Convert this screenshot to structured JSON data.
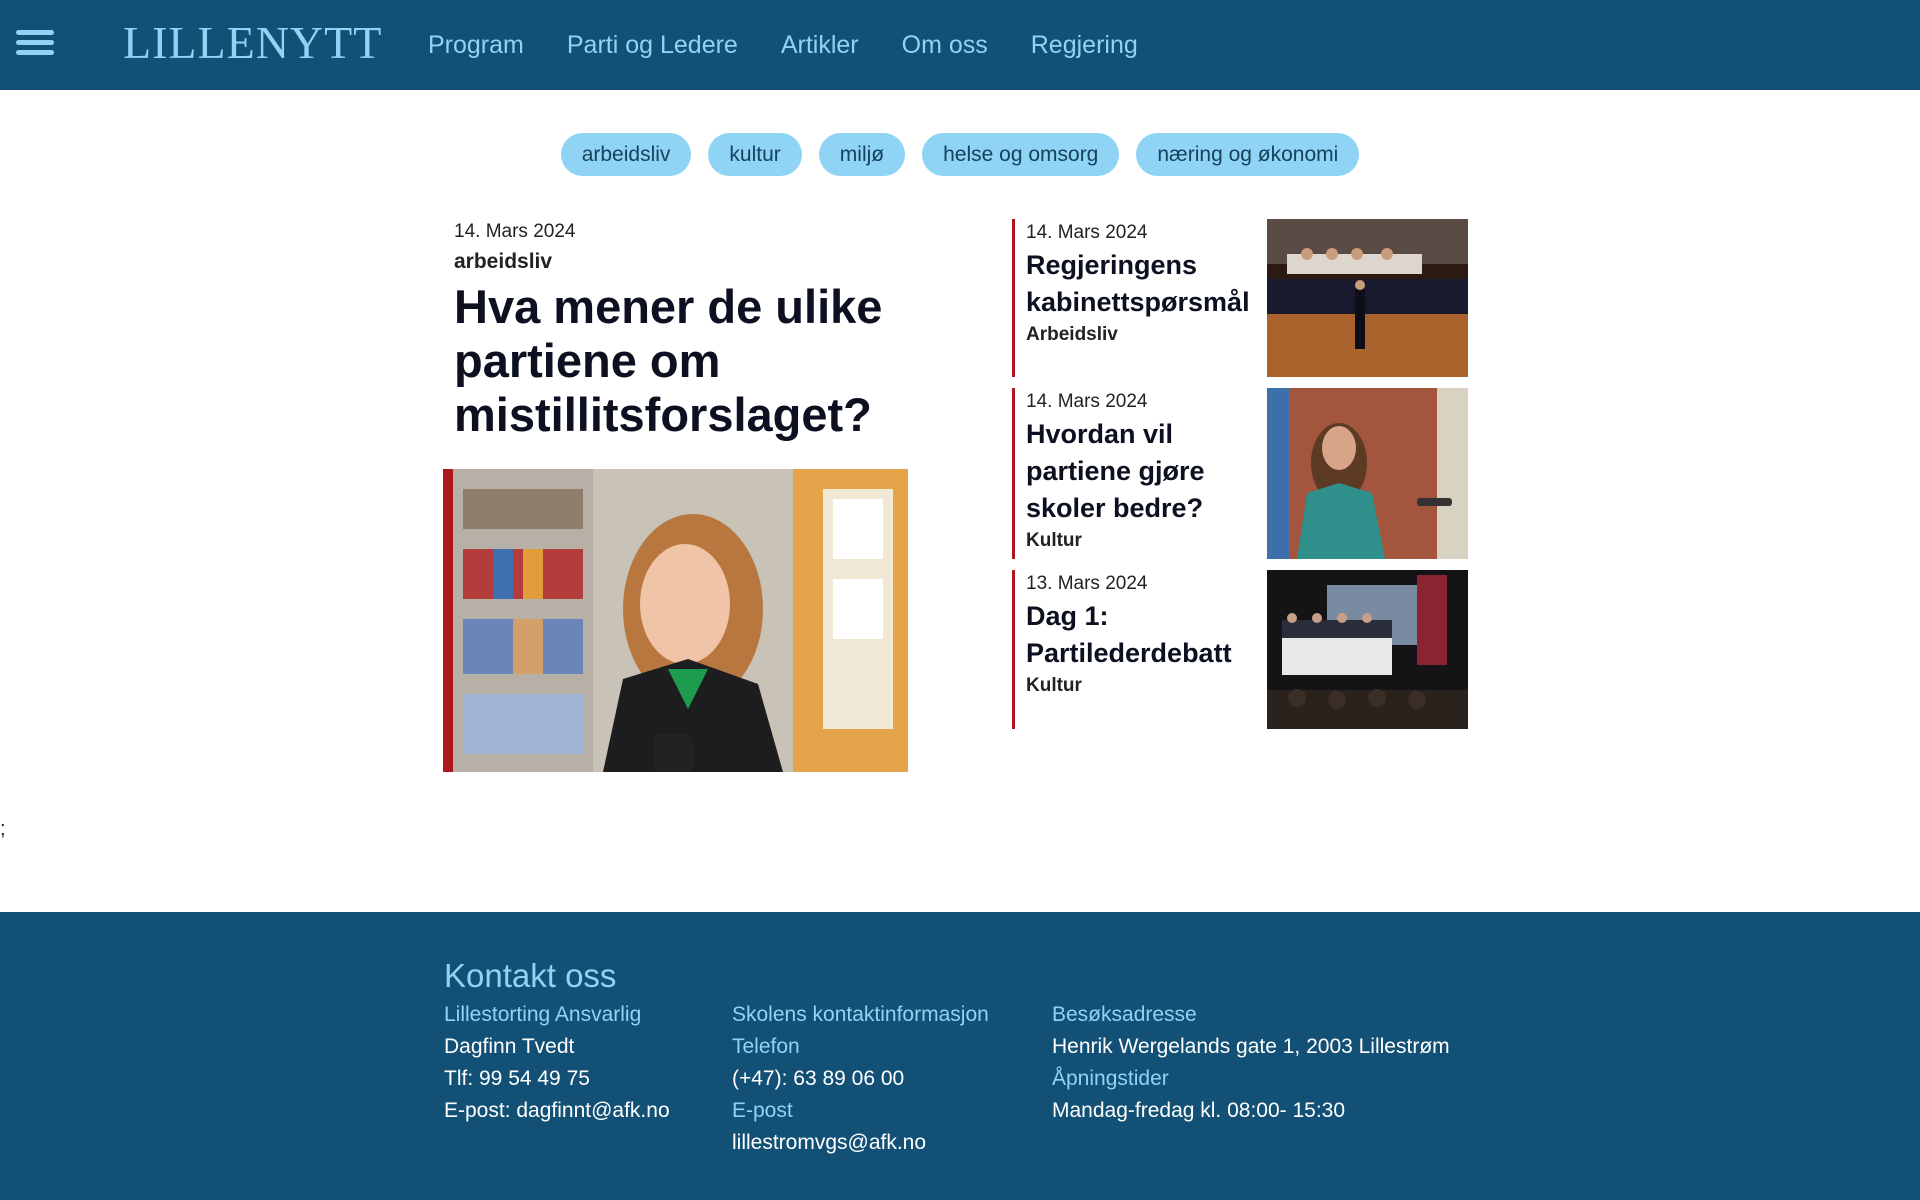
{
  "header": {
    "logo": "LILLENYTT",
    "nav": [
      "Program",
      "Parti og Ledere",
      "Artikler",
      "Om oss",
      "Regjering"
    ]
  },
  "tags": [
    "arbeidsliv",
    "kultur",
    "miljø",
    "helse og omsorg",
    "næring og økonomi"
  ],
  "main_article": {
    "date": "14. Mars 2024",
    "category": "arbeidsliv",
    "title": "Hva mener de ulike partiene om mistillitsforslaget?"
  },
  "side_articles": [
    {
      "date": "14. Mars 2024",
      "title": "Regjeringens kabinettspørsmål",
      "category": "Arbeidsliv"
    },
    {
      "date": "14. Mars 2024",
      "title": "Hvordan vil partiene gjøre skoler bedre?",
      "category": "Kultur"
    },
    {
      "date": "13. Mars 2024",
      "title": "Dag 1: Partilederdebatt",
      "category": "Kultur"
    }
  ],
  "stray_text": ";",
  "footer": {
    "title": "Kontakt oss",
    "col1": {
      "label": "Lillestorting Ansvarlig",
      "name": "Dagfinn Tvedt",
      "phone": "Tlf: 99 54 49 75",
      "email": "E-post: dagfinnt@afk.no"
    },
    "col2": {
      "label": "Skolens kontaktinformasjon",
      "phone_label": "Telefon",
      "phone": "(+47): 63 89 06 00",
      "email_label": "E-post",
      "email": "lillestromvgs@afk.no"
    },
    "col3": {
      "label": "Besøksadresse",
      "address": "Henrik Wergelands gate 1, 2003 Lillestrøm",
      "hours_label": "Åpningstider",
      "hours": "Mandag-fredag kl. 08:00- 15:30"
    }
  }
}
